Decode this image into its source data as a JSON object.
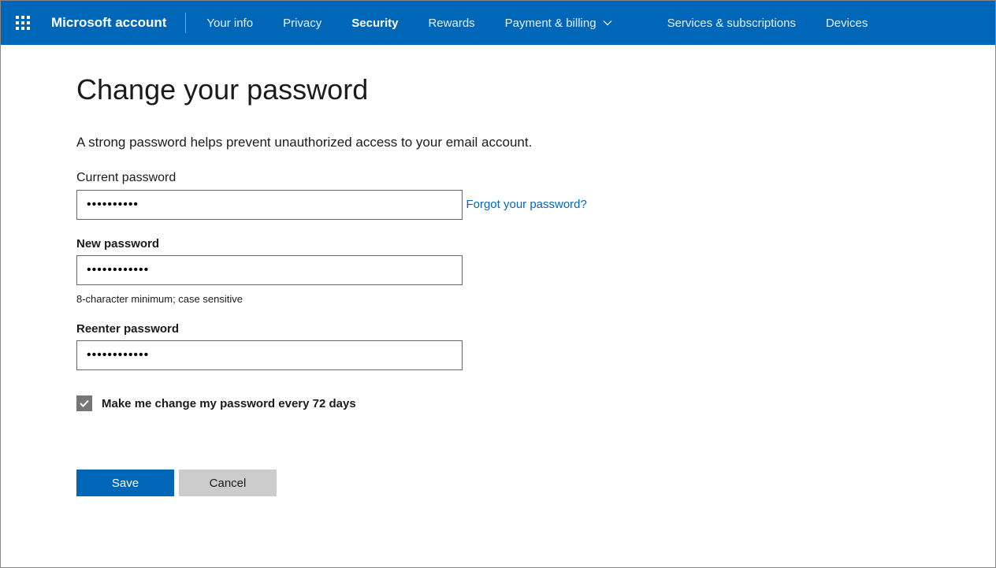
{
  "topbar": {
    "brand": "Microsoft account",
    "nav": [
      {
        "label": "Your info",
        "active": false
      },
      {
        "label": "Privacy",
        "active": false
      },
      {
        "label": "Security",
        "active": true
      },
      {
        "label": "Rewards",
        "active": false
      },
      {
        "label": "Payment & billing",
        "active": false,
        "dropdown": true
      },
      {
        "label": "Services & subscriptions",
        "active": false
      },
      {
        "label": "Devices",
        "active": false
      }
    ]
  },
  "page": {
    "title": "Change your password",
    "description": "A strong password helps prevent unauthorized access to your email account."
  },
  "form": {
    "current": {
      "label": "Current password",
      "value": "••••••••••",
      "forgot_link": "Forgot your password?"
    },
    "new": {
      "label": "New password",
      "value": "••••••••••••",
      "hint": "8-character minimum; case sensitive"
    },
    "reenter": {
      "label": "Reenter password",
      "value": "••••••••••••"
    },
    "expire": {
      "checked": true,
      "label": "Make me change my password every 72 days"
    },
    "buttons": {
      "save": "Save",
      "cancel": "Cancel"
    }
  }
}
